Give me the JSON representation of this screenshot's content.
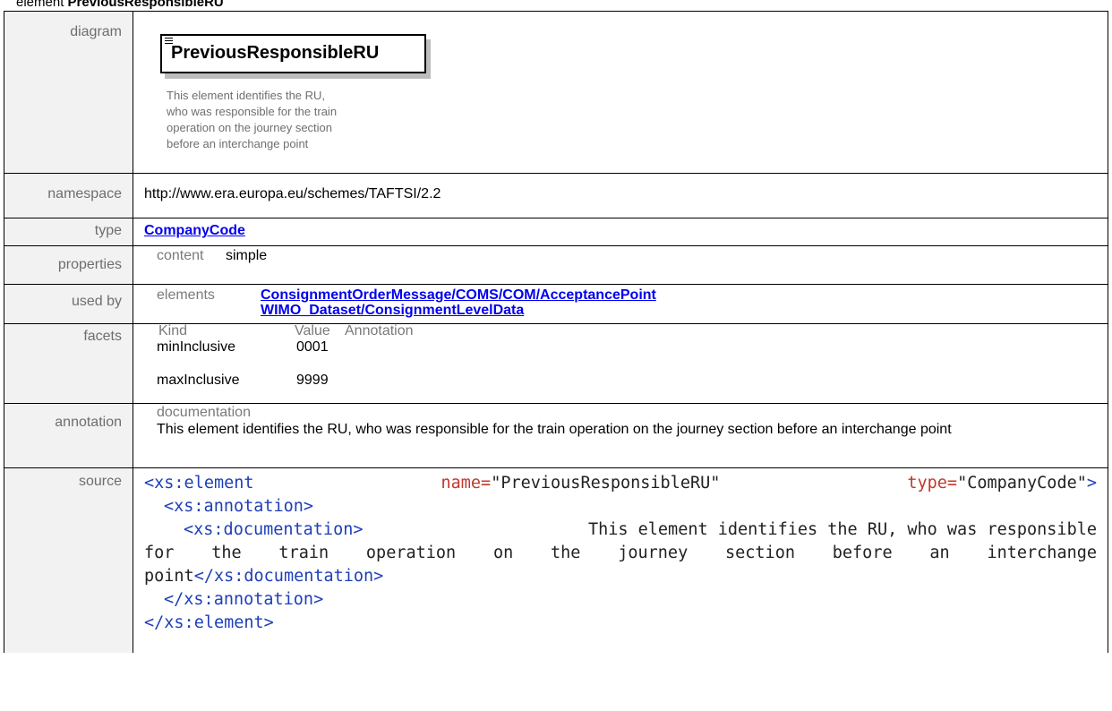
{
  "heading": {
    "prefix": "element",
    "name": "PreviousResponsibleRU"
  },
  "rows": {
    "diagram": {
      "label": "diagram",
      "element_name": "PreviousResponsibleRU",
      "description": "This element identifies the RU,\nwho was responsible for the train\noperation on the journey section\nbefore an interchange point"
    },
    "namespace": {
      "label": "namespace",
      "value": "http://www.era.europa.eu/schemes/TAFTSI/2.2"
    },
    "type": {
      "label": "type",
      "value": "CompanyCode"
    },
    "properties": {
      "label": "properties",
      "key": "content",
      "value": "simple"
    },
    "used_by": {
      "label": "used by",
      "key": "elements",
      "links": [
        "ConsignmentOrderMessage/COMS/COM/AcceptancePoint",
        "WIMO_Dataset/ConsignmentLevelData"
      ]
    },
    "facets": {
      "label": "facets",
      "headers": [
        "Kind",
        "Value",
        "Annotation"
      ],
      "rows": [
        {
          "kind": "minInclusive",
          "value": "0001"
        },
        {
          "kind": "maxInclusive",
          "value": "9999"
        }
      ]
    },
    "annotation": {
      "label": "annotation",
      "sublabel": "documentation",
      "text": "This element identifies the RU, who was responsible for the train operation on the journey section before an interchange point"
    },
    "source": {
      "label": "source",
      "line1_tag_open": "<xs:element",
      "line1_attr1": "name=",
      "line1_val1": "\"PreviousResponsibleRU\"",
      "line1_attr2": "type=",
      "line1_val2": "\"CompanyCode\"",
      "line1_close": ">",
      "line2": "<xs:annotation>",
      "line3_tag": "<xs:documentation>",
      "line3_text": "This element identifies the RU, who was responsible",
      "line4_text": "for the train operation on the journey section before an interchange",
      "line5_text": "point",
      "line5_tag": "</xs:documentation>",
      "line6": "</xs:annotation>",
      "line7": "</xs:element>"
    }
  }
}
